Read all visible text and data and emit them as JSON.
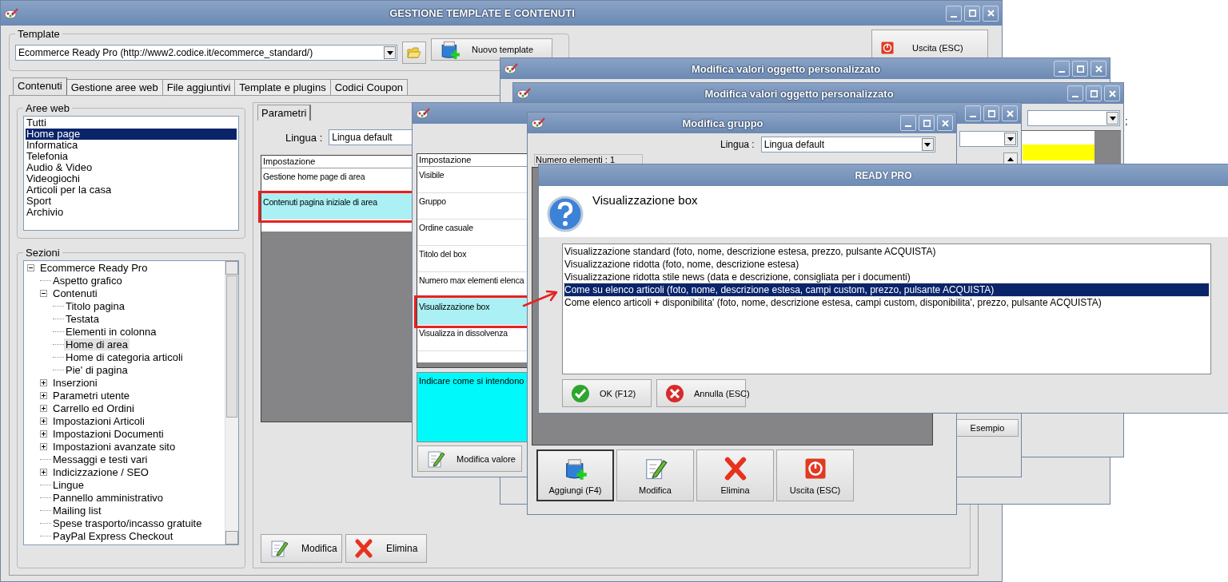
{
  "main_window": {
    "title": "GESTIONE TEMPLATE E CONTENUTI",
    "template_group": {
      "label": "Template",
      "value": "Ecommerce Ready Pro (http://www2.codice.it/ecommerce_standard/)",
      "new_button": "Nuovo template"
    },
    "exit_button": "Uscita (ESC)",
    "tabs": [
      {
        "label": "Contenuti",
        "selected": true
      },
      {
        "label": "Gestione aree web",
        "selected": false
      },
      {
        "label": "File aggiuntivi",
        "selected": false
      },
      {
        "label": "Template e plugins",
        "selected": false
      },
      {
        "label": "Codici Coupon",
        "selected": false
      }
    ],
    "aree_web": {
      "label": "Aree web",
      "items": [
        {
          "label": "Tutti",
          "selected": false
        },
        {
          "label": "Home page",
          "selected": true
        },
        {
          "label": "Informatica",
          "selected": false
        },
        {
          "label": "Telefonia",
          "selected": false
        },
        {
          "label": "Audio & Video",
          "selected": false
        },
        {
          "label": "Videogiochi",
          "selected": false
        },
        {
          "label": "Articoli per la casa",
          "selected": false
        },
        {
          "label": "Sport",
          "selected": false
        },
        {
          "label": "Archivio",
          "selected": false
        }
      ]
    },
    "sezioni": {
      "label": "Sezioni",
      "tree": [
        {
          "label": "Ecommerce Ready Pro",
          "kind": "folder",
          "expanded": true,
          "selected": false,
          "children": [
            {
              "label": "Aspetto grafico",
              "kind": "leaf",
              "selected": false
            },
            {
              "label": "Contenuti",
              "kind": "folder",
              "expanded": true,
              "selected": false,
              "children": [
                {
                  "label": "Titolo pagina",
                  "kind": "leaf",
                  "selected": false
                },
                {
                  "label": "Testata",
                  "kind": "leaf",
                  "selected": false
                },
                {
                  "label": "Elementi in colonna",
                  "kind": "leaf",
                  "selected": false
                },
                {
                  "label": "Home di area",
                  "kind": "leaf",
                  "selected": true
                },
                {
                  "label": "Home di categoria articoli",
                  "kind": "leaf",
                  "selected": false
                },
                {
                  "label": "Pie' di pagina",
                  "kind": "leaf",
                  "selected": false
                }
              ]
            },
            {
              "label": "Inserzioni",
              "kind": "folder",
              "expanded": false,
              "selected": false
            },
            {
              "label": "Parametri utente",
              "kind": "folder",
              "expanded": false,
              "selected": false
            },
            {
              "label": "Carrello ed Ordini",
              "kind": "folder",
              "expanded": false,
              "selected": false
            },
            {
              "label": "Impostazioni Articoli",
              "kind": "folder",
              "expanded": false,
              "selected": false
            },
            {
              "label": "Impostazioni Documenti",
              "kind": "folder",
              "expanded": false,
              "selected": false
            },
            {
              "label": "Impostazioni avanzate sito",
              "kind": "folder",
              "expanded": false,
              "selected": false
            },
            {
              "label": "Messaggi e testi vari",
              "kind": "leaf",
              "selected": false
            },
            {
              "label": "Indicizzazione / SEO",
              "kind": "folder",
              "expanded": false,
              "selected": false
            },
            {
              "label": "Lingue",
              "kind": "leaf",
              "selected": false
            },
            {
              "label": "Pannello amministrativo",
              "kind": "leaf",
              "selected": false
            },
            {
              "label": "Mailing list",
              "kind": "leaf",
              "selected": false
            },
            {
              "label": "Spese trasporto/incasso gratuite",
              "kind": "leaf",
              "selected": false
            },
            {
              "label": "PayPal Express Checkout",
              "kind": "leaf",
              "selected": false
            }
          ]
        }
      ]
    },
    "parametri": {
      "tab": "Parametri",
      "lingua_label": "Lingua :",
      "lingua_value": "Lingua default",
      "column": "Impostazione",
      "rows": [
        {
          "label": "Gestione home page di area",
          "selected": false,
          "highlighted": false
        },
        {
          "label": "Contenuti pagina iniziale di area",
          "selected": true,
          "highlighted": true
        }
      ],
      "buttons": [
        {
          "label": "Modifica",
          "kind": "edit"
        },
        {
          "label": "Elimina",
          "kind": "delete"
        }
      ]
    }
  },
  "custom_object_windows": [
    {
      "title": "Modifica valori oggetto personalizzato"
    },
    {
      "title": "Modifica valori oggetto personalizzato"
    }
  ],
  "desktop_text": ";",
  "settings_window": {
    "column": "Impostazione",
    "rows": [
      {
        "label": "Visibile",
        "selected": false,
        "highlighted": false
      },
      {
        "label": "Gruppo",
        "selected": false,
        "highlighted": false
      },
      {
        "label": "Ordine casuale",
        "selected": false,
        "highlighted": false
      },
      {
        "label": "Titolo del box",
        "selected": false,
        "highlighted": false
      },
      {
        "label": "Numero max elementi elenca",
        "selected": false,
        "highlighted": false
      },
      {
        "label": "Visualizzazione box",
        "selected": true,
        "highlighted": true
      },
      {
        "label": "Visualizza in dissolvenza",
        "selected": false,
        "highlighted": false
      }
    ],
    "description": "Indicare come si intendono",
    "edit_button": "Modifica valore",
    "example_button": "Esempio"
  },
  "group_window": {
    "title": "Modifica gruppo",
    "lingua_label": "Lingua :",
    "lingua_value": "Lingua default",
    "count": "Numero elementi : 1",
    "buttons": [
      {
        "label": "Aggiungi (F4)",
        "kind": "add",
        "default": true
      },
      {
        "label": "Modifica",
        "kind": "edit",
        "default": false
      },
      {
        "label": "Elimina",
        "kind": "delete",
        "default": false
      },
      {
        "label": "Uscita (ESC)",
        "kind": "exit",
        "default": false
      }
    ]
  },
  "dialog": {
    "title": "READY PRO",
    "heading": "Visualizzazione box",
    "options": [
      {
        "label": "Visualizzazione standard (foto, nome, descrizione estesa, prezzo, pulsante ACQUISTA)",
        "selected": false
      },
      {
        "label": "Visualizzazione ridotta (foto, nome, descrizione estesa)",
        "selected": false
      },
      {
        "label": "Visualizzazione ridotta stile news (data e descrizione, consigliata per i documenti)",
        "selected": false
      },
      {
        "label": "Come su elenco articoli (foto, nome, descrizione estesa, campi custom, prezzo, pulsante ACQUISTA)",
        "selected": true
      },
      {
        "label": "Come elenco articoli + disponibilita' (foto, nome, descrizione estesa, campi custom, disponibilita', prezzo, pulsante ACQUISTA)",
        "selected": false
      }
    ],
    "buttons": [
      {
        "label": "OK (F12)",
        "kind": "ok"
      },
      {
        "label": "Annulla (ESC)",
        "kind": "cancel"
      }
    ]
  }
}
